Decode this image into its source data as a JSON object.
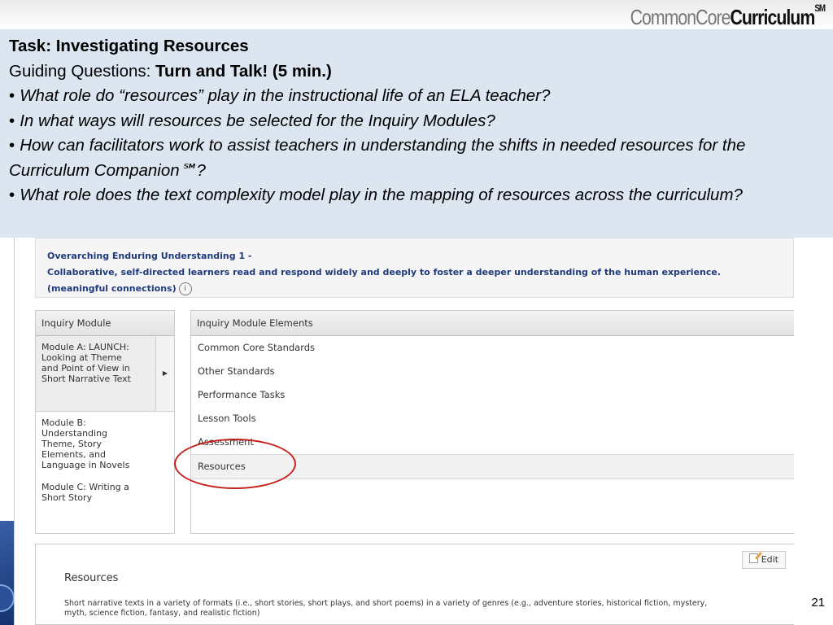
{
  "brand": {
    "light": "CommonCore",
    "bold": "Curriculum",
    "mark": "SM"
  },
  "task": {
    "title": "Task:  Investigating Resources",
    "guiding_label": "Guiding Questions: ",
    "guiding_bold": "Turn and Talk! (5 min.)",
    "questions": [
      "What role do “resources” play in the instructional life of an ELA teacher?",
      "In what ways will resources be selected for the Inquiry Modules?",
      "How can facilitators work to assist teachers in understanding the shifts in needed resources for the Curriculum Companion℠?",
      "What role does the text complexity model play in the mapping of resources across the curriculum?"
    ]
  },
  "app": {
    "enduring_understanding": {
      "line1": "Overarching Enduring Understanding 1 -",
      "line2": "Collaborative, self-directed learners read and respond widely and deeply to foster a deeper understanding of the human experience.",
      "line3": "(meaningful connections)",
      "info_icon": "info-icon"
    },
    "inquiry_module": {
      "header": "Inquiry Module",
      "modules": [
        "Module A: LAUNCH:  Looking at Theme and Point of View in Short Narrative Text",
        "Module B: Understanding Theme, Story Elements, and Language in Novels",
        "Module C: Writing a Short Story"
      ],
      "selected_index": 0
    },
    "elements": {
      "header": "Inquiry Module Elements",
      "items": [
        "Common Core Standards",
        "Other Standards",
        "Performance Tasks",
        "Lesson Tools",
        "Assessment",
        "Resources"
      ],
      "active_index": 5
    },
    "detail": {
      "edit_label": "Edit",
      "title": "Resources",
      "text": "Short narrative texts in a variety of formats (i.e., short stories, short plays, and short poems) in a variety of genres (e.g., adventure stories, historical fiction, mystery, myth, science fiction, fantasy, and realistic fiction)"
    },
    "annotation_color": "#c4201c"
  },
  "page_number": "21"
}
